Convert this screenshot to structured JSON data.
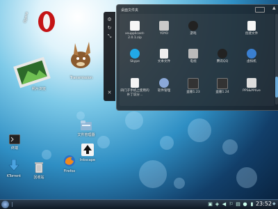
{
  "desktop": {
    "icons": [
      {
        "label": "Opera"
      },
      {
        "label": "Transmission"
      },
      {
        "label": "照片浏览"
      },
      {
        "label": "终端"
      },
      {
        "label": "文件管理器"
      },
      {
        "label": "KTorrent"
      },
      {
        "label": "回收站"
      },
      {
        "label": "Firefox"
      },
      {
        "label": "Inkscape"
      }
    ]
  },
  "panel": {
    "title": "桌面文件夹",
    "items": [
      {
        "label": "xsupplicant-2.0.1.zip"
      },
      {
        "label": "YOYO"
      },
      {
        "label": "游戏"
      },
      {
        "label": "创建文件"
      },
      {
        "label": "Skype"
      },
      {
        "label": "文本文件"
      },
      {
        "label": "电视"
      },
      {
        "label": "腾讯QQ"
      },
      {
        "label": "虚拟机"
      },
      {
        "label": "四门子手机上使用的补丁说分..."
      },
      {
        "label": "软件管理"
      },
      {
        "label": "盗墓1.23"
      },
      {
        "label": "盗墓1.24"
      },
      {
        "label": "PPS&PPlive"
      }
    ]
  },
  "taskbar": {
    "clock": "23:52"
  },
  "colors": {
    "taskbar_bg": "#101a25",
    "panel_bg": "#1c2228",
    "accent": "#6aa9d8"
  }
}
